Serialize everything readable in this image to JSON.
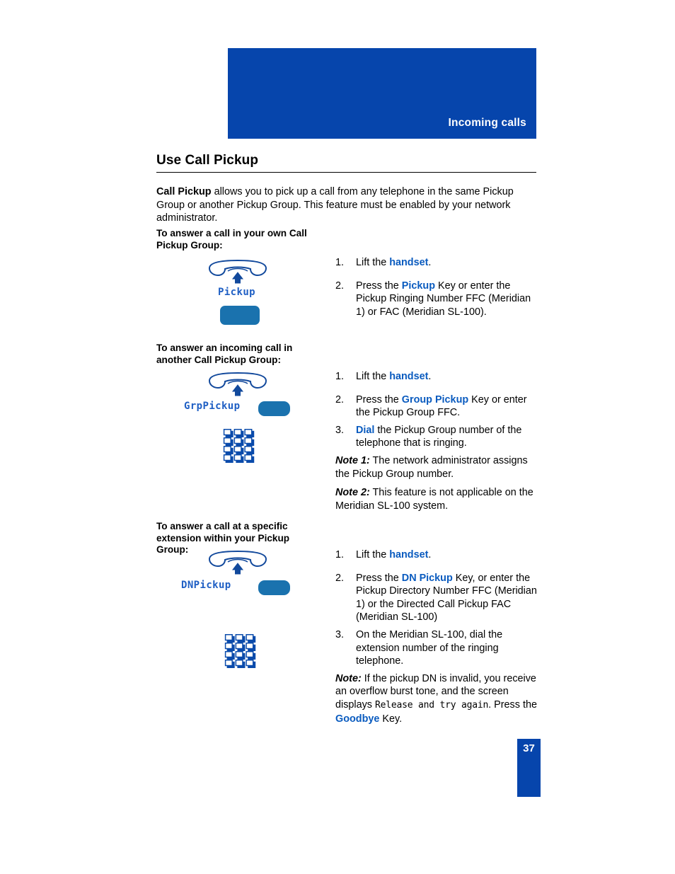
{
  "header": {
    "chapter_title": "Incoming calls"
  },
  "page": {
    "title": "Use Call Pickup",
    "number": "37",
    "intro_bold": "Call Pickup",
    "intro_rest": " allows you to pick up a call from any telephone in the same Pickup Group or another Pickup Group. This feature must be enabled by your network administrator."
  },
  "colors": {
    "banner_blue": "#0645ac",
    "softkey_blue": "#1a72ae",
    "keyword_blue": "#0a5bbf",
    "lcd_blue": "#1f5fc4"
  },
  "sections": [
    {
      "label": "To answer a call in your own Call Pickup Group:",
      "softkey_label": "Pickup",
      "steps": [
        {
          "num": "1.",
          "parts": [
            {
              "t": "Lift the ",
              "k": false
            },
            {
              "t": "handset",
              "k": true
            },
            {
              "t": ".",
              "k": false
            }
          ]
        },
        {
          "num": "2.",
          "parts": [
            {
              "t": "Press the ",
              "k": false
            },
            {
              "t": "Pickup",
              "k": true
            },
            {
              "t": " Key or enter the Pickup Ringing Number FFC (Meridian 1) or FAC (Meridian SL-100).",
              "k": false
            }
          ]
        }
      ],
      "notes": []
    },
    {
      "label": "To answer an incoming call in another Call Pickup Group:",
      "softkey_label": "GrpPickup",
      "steps": [
        {
          "num": "1.",
          "parts": [
            {
              "t": "Lift the ",
              "k": false
            },
            {
              "t": "handset",
              "k": true
            },
            {
              "t": ".",
              "k": false
            }
          ]
        },
        {
          "num": "2.",
          "parts": [
            {
              "t": "Press the ",
              "k": false
            },
            {
              "t": "Group Pickup",
              "k": true
            },
            {
              "t": " Key or enter the Pickup Group FFC.",
              "k": false
            }
          ]
        },
        {
          "num": "3.",
          "parts": [
            {
              "t": "Dial",
              "k": true
            },
            {
              "t": " the Pickup Group number of the telephone that is ringing.",
              "k": false
            }
          ]
        }
      ],
      "notes": [
        {
          "lead": "Note 1:",
          "body": " The network administrator assigns the Pickup Group number."
        },
        {
          "lead": "Note 2:",
          "body": "  This feature is not applicable on the Meridian SL-100 system."
        }
      ]
    },
    {
      "label": "To answer a call at a specific extension within your Pickup Group:",
      "softkey_label": "DNPickup",
      "steps": [
        {
          "num": "1.",
          "parts": [
            {
              "t": "Lift the ",
              "k": false
            },
            {
              "t": "handset",
              "k": true
            },
            {
              "t": ".",
              "k": false
            }
          ]
        },
        {
          "num": "2.",
          "parts": [
            {
              "t": "Press the ",
              "k": false
            },
            {
              "t": "DN Pickup",
              "k": true
            },
            {
              "t": " Key, or enter the Pickup Directory Number FFC (Meridian 1) or the Directed Call Pickup FAC (Meridian SL-100)",
              "k": false
            }
          ]
        },
        {
          "num": "3.",
          "parts": [
            {
              "t": "On the Meridian SL-100, dial the extension number of the ringing telephone.",
              "k": false
            }
          ]
        }
      ],
      "notes": [
        {
          "lead": "Note:",
          "body_before": " If the pickup DN is invalid, you receive an overflow burst tone, and the screen displays ",
          "lcd": "Release and try again",
          "body_mid": ". Press the ",
          "keyword": "Goodbye",
          "body_after": " Key."
        }
      ]
    }
  ],
  "icons": {
    "handset": "handset-icon",
    "keypad": "keypad-icon"
  }
}
